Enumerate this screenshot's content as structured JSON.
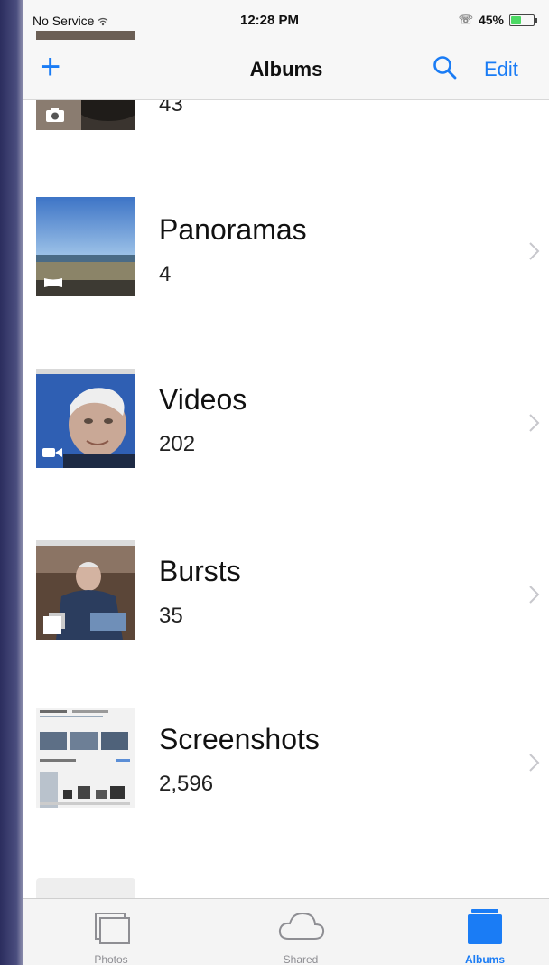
{
  "status_bar": {
    "carrier": "No Service",
    "time": "12:28 PM",
    "battery_percent": "45%",
    "battery_level": 0.45
  },
  "nav": {
    "add_label": "+",
    "title": "Albums",
    "edit_label": "Edit"
  },
  "albums": [
    {
      "name": "",
      "count": "43"
    },
    {
      "name": "Panoramas",
      "count": "4"
    },
    {
      "name": "Videos",
      "count": "202"
    },
    {
      "name": "Bursts",
      "count": "35"
    },
    {
      "name": "Screenshots",
      "count": "2,596"
    }
  ],
  "tabs": [
    {
      "label": "Photos",
      "icon": "photos-icon",
      "active": false
    },
    {
      "label": "Shared",
      "icon": "cloud-icon",
      "active": false
    },
    {
      "label": "Albums",
      "icon": "albums-icon",
      "active": true
    }
  ],
  "colors": {
    "accent": "#1a7cf5",
    "battery": "#4cd964",
    "inactive_tab": "#8e8e93"
  }
}
